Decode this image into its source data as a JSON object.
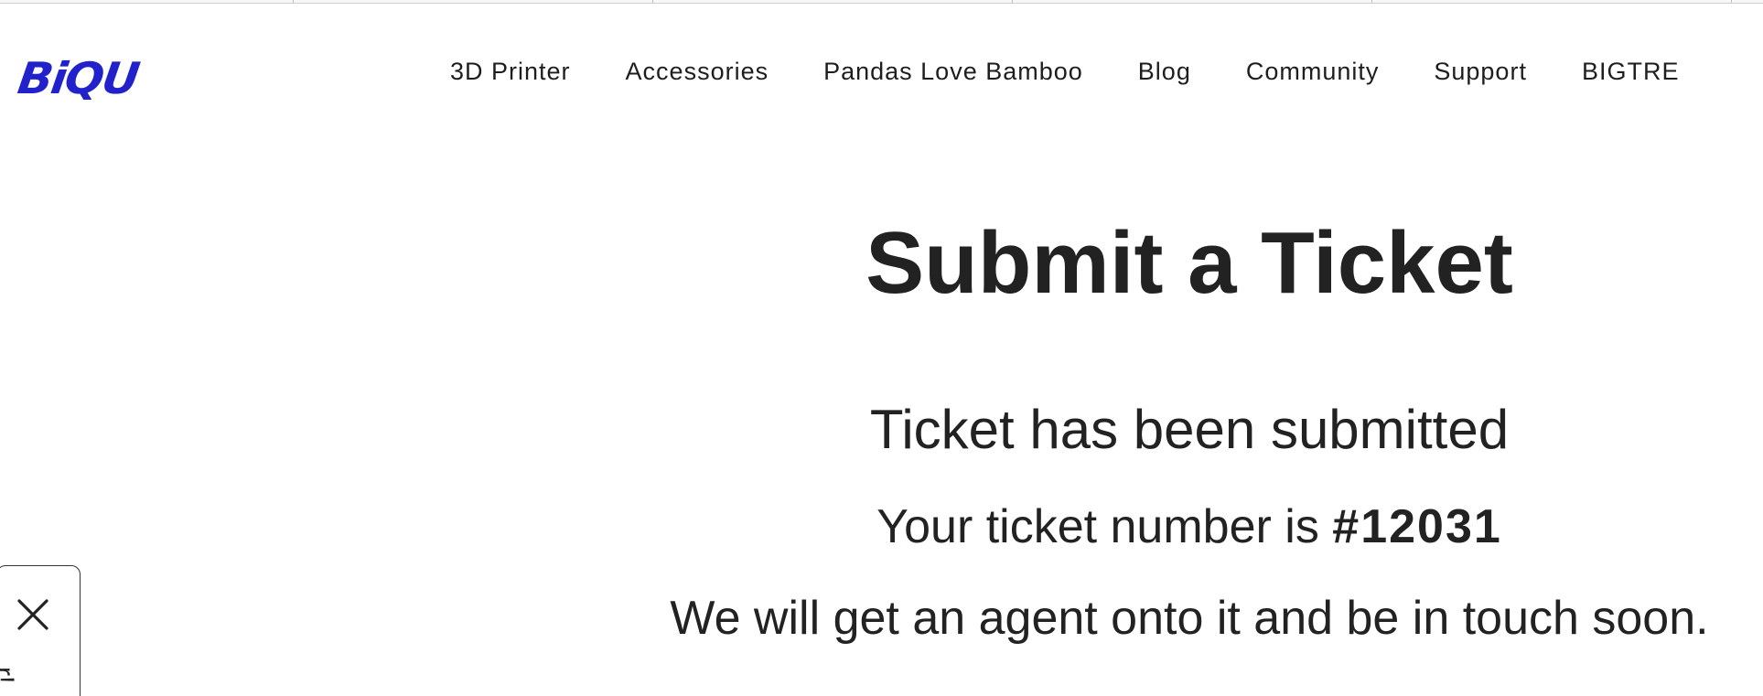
{
  "logo": {
    "text": "BiQU",
    "color": "#2222cc"
  },
  "nav": {
    "items": [
      {
        "label": "3D Printer"
      },
      {
        "label": "Accessories"
      },
      {
        "label": "Pandas Love Bamboo"
      },
      {
        "label": "Blog"
      },
      {
        "label": "Community"
      },
      {
        "label": "Support"
      },
      {
        "label": "BIGTRE"
      }
    ]
  },
  "main": {
    "title": "Submit a Ticket",
    "submitted_text": "Ticket has been submitted",
    "ticket_prefix": "Your ticket number is ",
    "ticket_number": "#12031",
    "followup_text": "We will get an agent onto it and be in touch soon."
  },
  "side_widget": {
    "close_icon": "close-icon",
    "text": "r!"
  }
}
